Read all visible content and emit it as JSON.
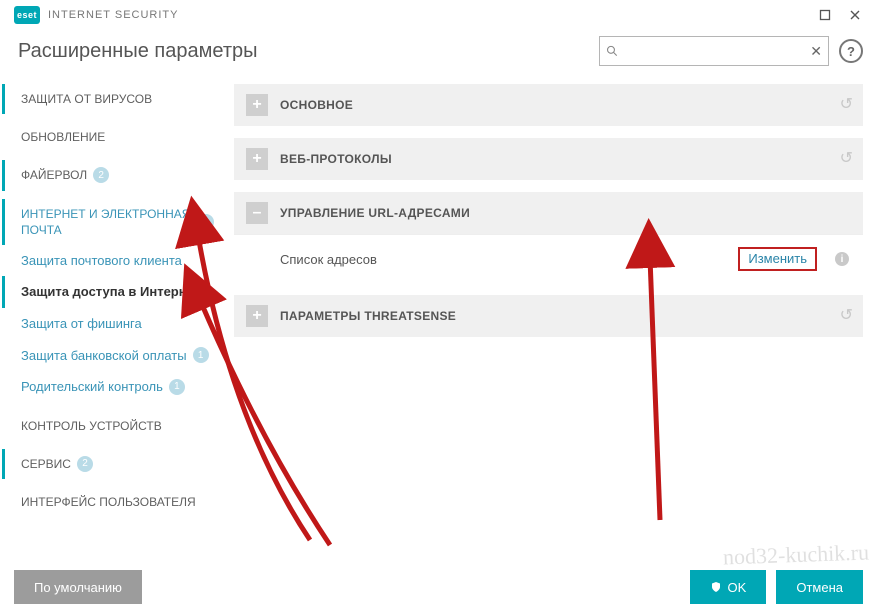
{
  "brand": {
    "logo": "eset",
    "product": "INTERNET SECURITY"
  },
  "window": {
    "page_title": "Расширенные параметры"
  },
  "search": {
    "placeholder": ""
  },
  "sidebar": {
    "items": [
      {
        "label": "ЗАЩИТА ОТ ВИРУСОВ"
      },
      {
        "label": "ОБНОВЛЕНИЕ"
      },
      {
        "label": "ФАЙЕРВОЛ",
        "badge": "2"
      },
      {
        "label": "ИНТЕРНЕТ И ЭЛЕКТРОННАЯ ПОЧТА",
        "badge": "1"
      },
      {
        "label": "Защита почтового клиента"
      },
      {
        "label": "Защита доступа в Интернет"
      },
      {
        "label": "Защита от фишинга"
      },
      {
        "label": "Защита банковской оплаты",
        "badge": "1"
      },
      {
        "label": "Родительский контроль",
        "badge": "1"
      },
      {
        "label": "КОНТРОЛЬ УСТРОЙСТВ"
      },
      {
        "label": "СЕРВИС",
        "badge": "2"
      },
      {
        "label": "ИНТЕРФЕЙС ПОЛЬЗОВАТЕЛЯ"
      }
    ]
  },
  "panels": {
    "basic": {
      "title": "ОСНОВНОЕ",
      "icon": "+"
    },
    "web": {
      "title": "ВЕБ-ПРОТОКОЛЫ",
      "icon": "+"
    },
    "url": {
      "title": "УПРАВЛЕНИЕ URL-АДРЕСАМИ",
      "icon": "–",
      "row_label": "Список адресов",
      "row_action": "Изменить"
    },
    "threat": {
      "title": "ПАРАМЕТРЫ THREATSENSE",
      "icon": "+"
    }
  },
  "footer": {
    "defaults": "По умолчанию",
    "ok": "OK",
    "cancel": "Отмена"
  },
  "watermark": "nod32-kuchik.ru"
}
